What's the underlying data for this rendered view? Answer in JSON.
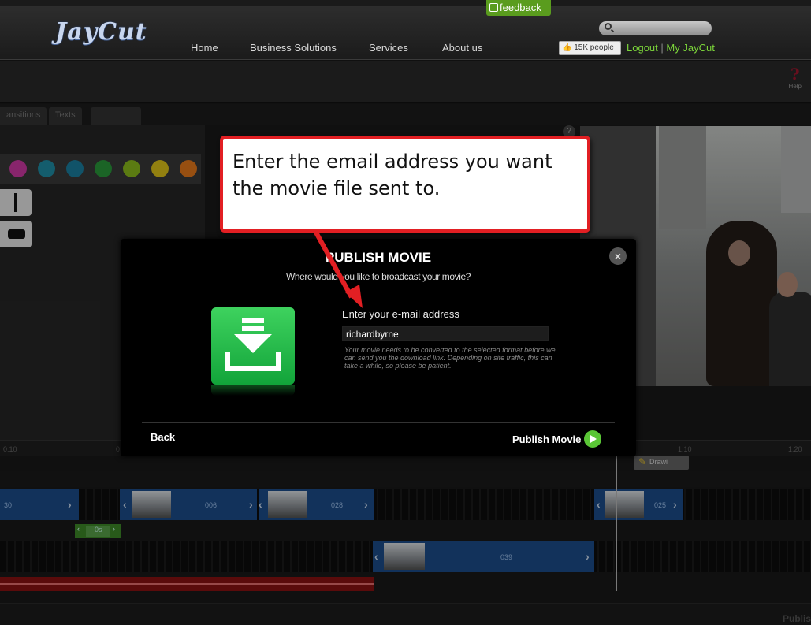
{
  "header": {
    "logo": "JayCut",
    "nav": [
      "Home",
      "Business Solutions",
      "Services",
      "About us"
    ],
    "feedback_label": "feedback",
    "search_placeholder": "",
    "like_label": "15K people",
    "logout_label": "Logout",
    "myjaycut_label": "My JayCut",
    "separator": "|"
  },
  "toolbar": {
    "help_label": "Help"
  },
  "tabs": [
    "ansitions",
    "Texts",
    ""
  ],
  "swatch_colors": [
    "#d23aa7",
    "#1f8fa8",
    "#1b80a2",
    "#2a9a3b",
    "#8cbd1c",
    "#e1c51a",
    "#e87a1b"
  ],
  "timeline": {
    "ruler_labels": [
      "0:10",
      "0",
      "1:10",
      "1:20"
    ],
    "clips": [
      {
        "label": "30"
      },
      {
        "label": "006"
      },
      {
        "label": "028"
      },
      {
        "label": "025"
      }
    ],
    "clip_bottom_label": "039",
    "green_clip_label": "0s",
    "draw_label": "Drawi",
    "bottom_right_label": "Publis"
  },
  "modal": {
    "title": "PUBLISH MOVIE",
    "subtitle": "Where would you like to broadcast your movie?",
    "email_label": "Enter your e-mail address",
    "email_value": "richardbyrne",
    "note": "Your movie needs to be converted to the selected format before we can send you the download link. Depending on site traffic, this can take a while, so please be patient.",
    "back_label": "Back",
    "publish_label": "Publish Movie",
    "close_symbol": "×"
  },
  "callout": {
    "text": "Enter the email address you want the movie file sent to."
  },
  "colors": {
    "accent_green": "#5ac636",
    "callout_border": "#e21f23",
    "clip_blue": "#1d4d8c"
  }
}
